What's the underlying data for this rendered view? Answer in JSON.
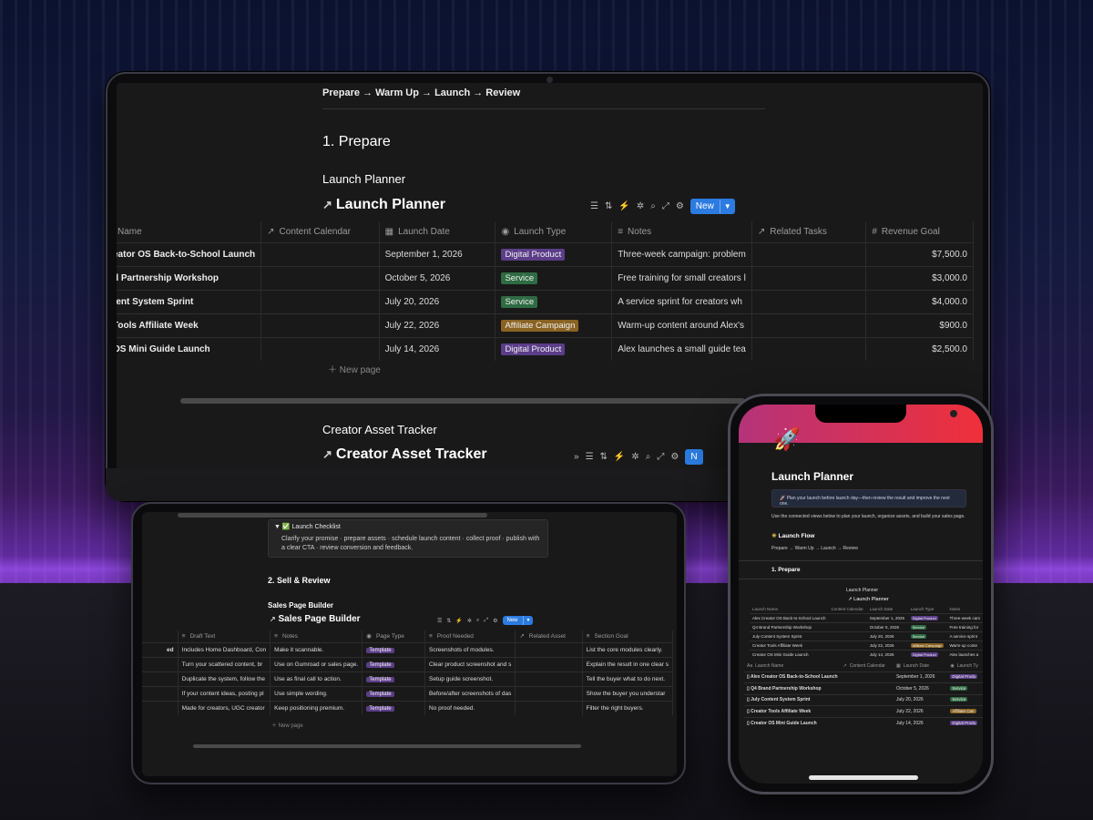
{
  "flow": "Prepare → Warm Up → Launch → Review",
  "section1": "1. Prepare",
  "launch_planner": {
    "heading": "Launch Planner",
    "db_title": "Launch Planner",
    "new_label": "New",
    "columns": [
      "Name",
      "Content Calendar",
      "Launch Date",
      "Launch Type",
      "Notes",
      "Related Tasks",
      "Revenue Goal"
    ],
    "rows": [
      {
        "name": "eator OS Back-to-School Launch",
        "date": "September 1, 2026",
        "type": "Digital Product",
        "type_key": "dp",
        "notes": "Three-week campaign: problem",
        "goal": "$7,500.0"
      },
      {
        "name": "d Partnership Workshop",
        "date": "October 5, 2026",
        "type": "Service",
        "type_key": "sv",
        "notes": "Free training for small creators l",
        "goal": "$3,000.0"
      },
      {
        "name": "tent System Sprint",
        "date": "July 20, 2026",
        "type": "Service",
        "type_key": "sv",
        "notes": "A service sprint for creators wh",
        "goal": "$4,000.0"
      },
      {
        "name": "Tools Affiliate Week",
        "date": "July 22, 2026",
        "type": "Affiliate Campaign",
        "type_key": "af",
        "notes": "Warm-up content around Alex's",
        "goal": "$900.0"
      },
      {
        "name": "OS Mini Guide Launch",
        "date": "July 14, 2026",
        "type": "Digital Product",
        "type_key": "dp",
        "notes": "Alex launches a small guide tea",
        "goal": "$2,500.0"
      }
    ],
    "new_page": "New page"
  },
  "asset_tracker": {
    "heading": "Creator Asset Tracker",
    "db_title": "Creator Asset Tracker",
    "new_label": "N"
  },
  "tablet": {
    "checklist_title": "✅ Launch Checklist",
    "checklist_text": "Clarify your promise · prepare assets · schedule launch content · collect proof · publish with a clear CTA · review conversion and feedback.",
    "section2": "2. Sell & Review",
    "heading": "Sales Page Builder",
    "db_title": "Sales Page Builder",
    "new_label": "New",
    "columns": [
      "",
      "Draft Text",
      "Notes",
      "Page Type",
      "Proof Needed",
      "Related Asset",
      "Section Goal"
    ],
    "rows": [
      {
        "name": "ed",
        "draft": "Includes Home Dashboard, Con",
        "notes": "Make it scannable.",
        "type": "Template",
        "proof": "Screenshots of modules.",
        "goal": "List the core modules clearly."
      },
      {
        "name": "",
        "draft": "Turn your scattered content, br",
        "notes": "Use on Gumroad or sales page.",
        "type": "Template",
        "proof": "Clear product screenshot and s",
        "goal": "Explain the result in one clear s"
      },
      {
        "name": "",
        "draft": "Duplicate the system, follow the",
        "notes": "Use as final call to action.",
        "type": "Template",
        "proof": "Setup guide screenshot.",
        "goal": "Tell the buyer what to do next."
      },
      {
        "name": "",
        "draft": "If your content ideas, posting pl",
        "notes": "Use simple wording.",
        "type": "Template",
        "proof": "Before/after screenshots of das",
        "goal": "Show the buyer you understar"
      },
      {
        "name": "",
        "draft": "Made for creators, UGC creator",
        "notes": "Keep positioning premium.",
        "type": "Template",
        "proof": "No proof needed.",
        "goal": "Filter the right buyers."
      }
    ],
    "new_page": "New page"
  },
  "phone": {
    "title": "Launch Planner",
    "callout": "🚀 Plan your launch before launch day—then review the result and improve the next one.",
    "desc": "Use the connected views below to plan your launch, organize assets, and build your sales page.",
    "flow_heading": "Launch Flow",
    "flow": "Prepare → Warm Up → Launch → Review",
    "section1": "1. Prepare",
    "mini_heading": "Launch Planner",
    "mini_db": "Launch Planner",
    "mini_columns": [
      "Launch Name",
      "Content Calendar",
      "Launch Date",
      "Launch Type",
      "Notes"
    ],
    "mini_rows": [
      {
        "name": "Alex Creator OS Back-to-School Launch",
        "date": "September 1, 2026",
        "type": "Digital Product",
        "type_key": "dp",
        "notes": "Three-week cam"
      },
      {
        "name": "Q4 Brand Partnership Workshop",
        "date": "October 5, 2026",
        "type": "Service",
        "type_key": "sv",
        "notes": "Free training for"
      },
      {
        "name": "July Content System Sprint",
        "date": "July 20, 2026",
        "type": "Service",
        "type_key": "sv",
        "notes": "A service sprint"
      },
      {
        "name": "Creator Tools Affiliate Week",
        "date": "July 22, 2026",
        "type": "Affiliate Campaign",
        "type_key": "af",
        "notes": "Warm-up conte"
      },
      {
        "name": "Creator OS Mini Guide Launch",
        "date": "July 14, 2026",
        "type": "Digital Product",
        "type_key": "dp",
        "notes": "Alex launches a"
      }
    ],
    "columns": [
      "Launch Name",
      "Content Calendar",
      "Launch Date",
      "Launch Ty"
    ],
    "rows": [
      {
        "name": "Alex Creator OS Back-to-School Launch",
        "date": "September 1, 2026",
        "type": "Digital Produ",
        "type_key": "dp"
      },
      {
        "name": "Q4 Brand Partnership Workshop",
        "date": "October 5, 2026",
        "type": "Service",
        "type_key": "sv"
      },
      {
        "name": "July Content System Sprint",
        "date": "July 20, 2026",
        "type": "Service",
        "type_key": "sv"
      },
      {
        "name": "Creator Tools Affiliate Week",
        "date": "July 22, 2026",
        "type": "Affiliate Can",
        "type_key": "af"
      },
      {
        "name": "Creator OS Mini Guide Launch",
        "date": "July 14, 2026",
        "type": "Digital Produ",
        "type_key": "dp"
      }
    ]
  }
}
